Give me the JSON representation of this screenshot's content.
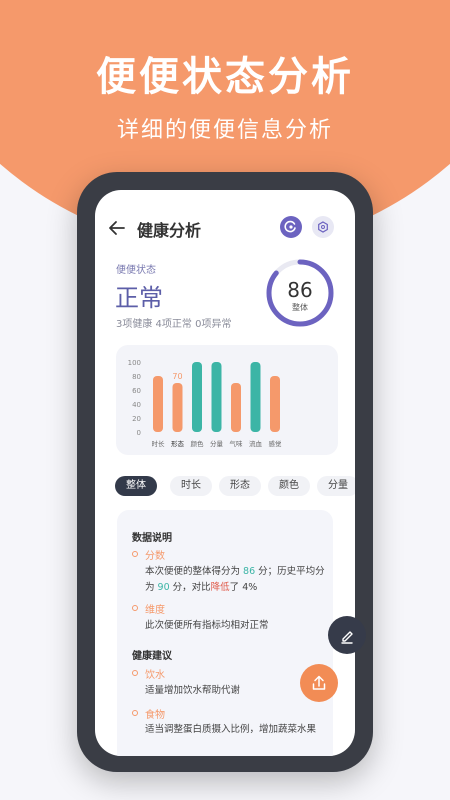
{
  "hero": {
    "title": "便便状态分析",
    "subtitle": "详细的便便信息分析"
  },
  "header": {
    "title": "健康分析"
  },
  "status": {
    "label": "便便状态",
    "value": "正常",
    "summary": "3项健康  4项正常  0项异常",
    "score": "86",
    "score_label": "整体",
    "score_fraction": 0.86
  },
  "colors": {
    "accent": "#f5996b",
    "primary": "#6c63c0",
    "teal": "#3cb5a6",
    "orange_bar": "#f5996b"
  },
  "chart_data": {
    "type": "bar",
    "categories": [
      "时长",
      "形态",
      "颜色",
      "分量",
      "气味",
      "流血",
      "感觉"
    ],
    "values": [
      80,
      70,
      100,
      100,
      70,
      100,
      80
    ],
    "bar_colors": [
      "#f5996b",
      "#f5996b",
      "#3cb5a6",
      "#3cb5a6",
      "#f5996b",
      "#3cb5a6",
      "#f5996b"
    ],
    "highlight_index": 1,
    "highlight_label": "70",
    "yticks": [
      "100",
      "80",
      "60",
      "40",
      "20",
      "0"
    ],
    "ylim": [
      0,
      100
    ]
  },
  "chips": [
    "整体",
    "时长",
    "形态",
    "颜色",
    "分量"
  ],
  "info": {
    "data_title": "数据说明",
    "score_label": "分数",
    "score_text_1": "本次便便的整体得分为 ",
    "score_num": "86",
    "score_text_2": " 分；历史平均分为 ",
    "avg_num": "90",
    "score_text_3": " 分，对比",
    "trend_word": "降低",
    "score_text_4": "了 4%",
    "dim_label": "维度",
    "dim_text": "此次便便所有指标均相对正常",
    "advice_title": "健康建议",
    "water_label": "饮水",
    "water_text": "适量增加饮水帮助代谢",
    "food_label": "食物",
    "food_text": "适当调整蛋白质摄入比例，增加蔬菜水果"
  }
}
